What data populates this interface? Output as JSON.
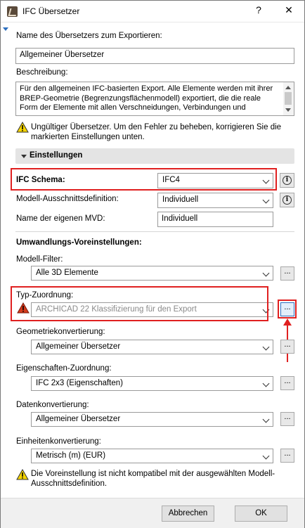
{
  "window": {
    "title": "IFC Übersetzer",
    "help": "?",
    "close": "✕"
  },
  "exporter": {
    "name_label": "Name des Übersetzers zum Exportieren:",
    "name_value": "Allgemeiner Übersetzer",
    "desc_label": "Beschreibung:",
    "desc_value": "Für den allgemeinen IFC-basierten Export. Alle Elemente werden mit ihrer BREP-Geometrie (Begrenzungsflächenmodell) exportiert, die die reale Form der Elemente mit allen Verschneidungen, Verbindungen und",
    "warning": "Ungültiger Übersetzer. Um den Fehler zu beheben, korrigieren Sie die markierten Einstellungen unten."
  },
  "settings": {
    "header": "Einstellungen",
    "schema_label": "IFC Schema:",
    "schema_value": "IFC4",
    "mvd_label": "Modell-Ausschnittsdefinition:",
    "mvd_value": "Individuell",
    "custom_mvd_label": "Name der eigenen MVD:",
    "custom_mvd_value": "Individuell",
    "info_glyph": "i"
  },
  "presets": {
    "title": "Umwandlungs-Voreinstellungen:",
    "filter_label": "Modell-Filter:",
    "filter_value": "Alle 3D Elemente",
    "type_label": "Typ-Zuordnung:",
    "type_value": "ARCHICAD 22 Klassifizierung für den Export",
    "geometry_label": "Geometriekonvertierung:",
    "geometry_value": "Allgemeiner Übersetzer",
    "props_label": "Eigenschaften-Zuordnung:",
    "props_value": "IFC 2x3 (Eigenschaften)",
    "data_label": "Datenkonvertierung:",
    "data_value": "Allgemeiner Übersetzer",
    "units_label": "Einheitenkonvertierung:",
    "units_value": "Metrisch (m) (EUR)",
    "units_warning": "Die Voreinstellung ist nicht kompatibel mit der ausgewählten Modell-Ausschnittsdefinition.",
    "dots": "..."
  },
  "footer": {
    "cancel": "Abbrechen",
    "ok": "OK"
  },
  "colors": {
    "highlight": "#e02020",
    "accent": "#2d6fbf"
  }
}
